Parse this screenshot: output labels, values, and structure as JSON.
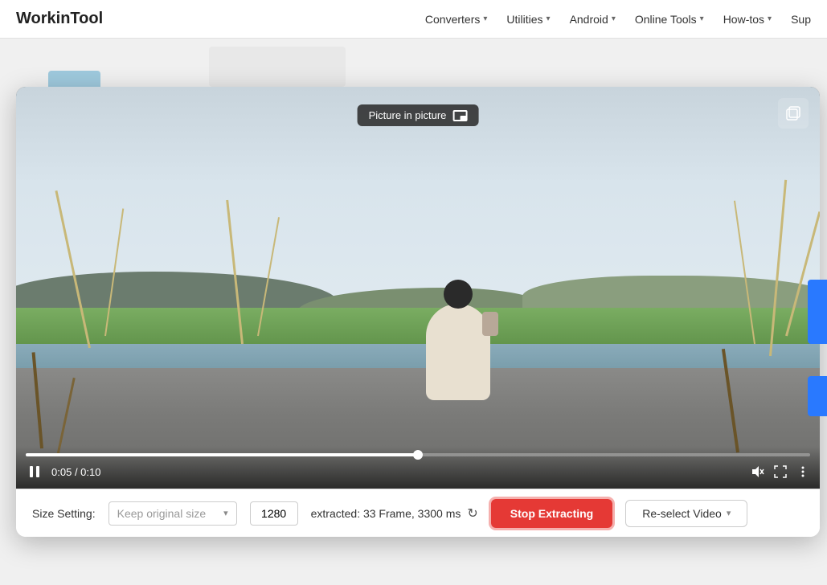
{
  "navbar": {
    "logo": "WorkinTool",
    "links": [
      {
        "label": "Converters",
        "hasDropdown": true
      },
      {
        "label": "Utilities",
        "hasDropdown": true
      },
      {
        "label": "Android",
        "hasDropdown": true
      },
      {
        "label": "Online Tools",
        "hasDropdown": true
      },
      {
        "label": "How-tos",
        "hasDropdown": true
      },
      {
        "label": "Sup",
        "hasDropdown": false
      }
    ]
  },
  "video": {
    "pip_tooltip": "Picture in picture",
    "time_current": "0:05",
    "time_total": "0:10",
    "progress_percent": 50
  },
  "bottom_bar": {
    "size_setting_label": "Size Setting:",
    "size_dropdown_placeholder": "Keep original size",
    "size_value": "1280",
    "extracted_info": "extracted: 33 Frame, 3300 ms",
    "stop_button_label": "Stop Extracting",
    "reselect_button_label": "Re-select Video"
  }
}
